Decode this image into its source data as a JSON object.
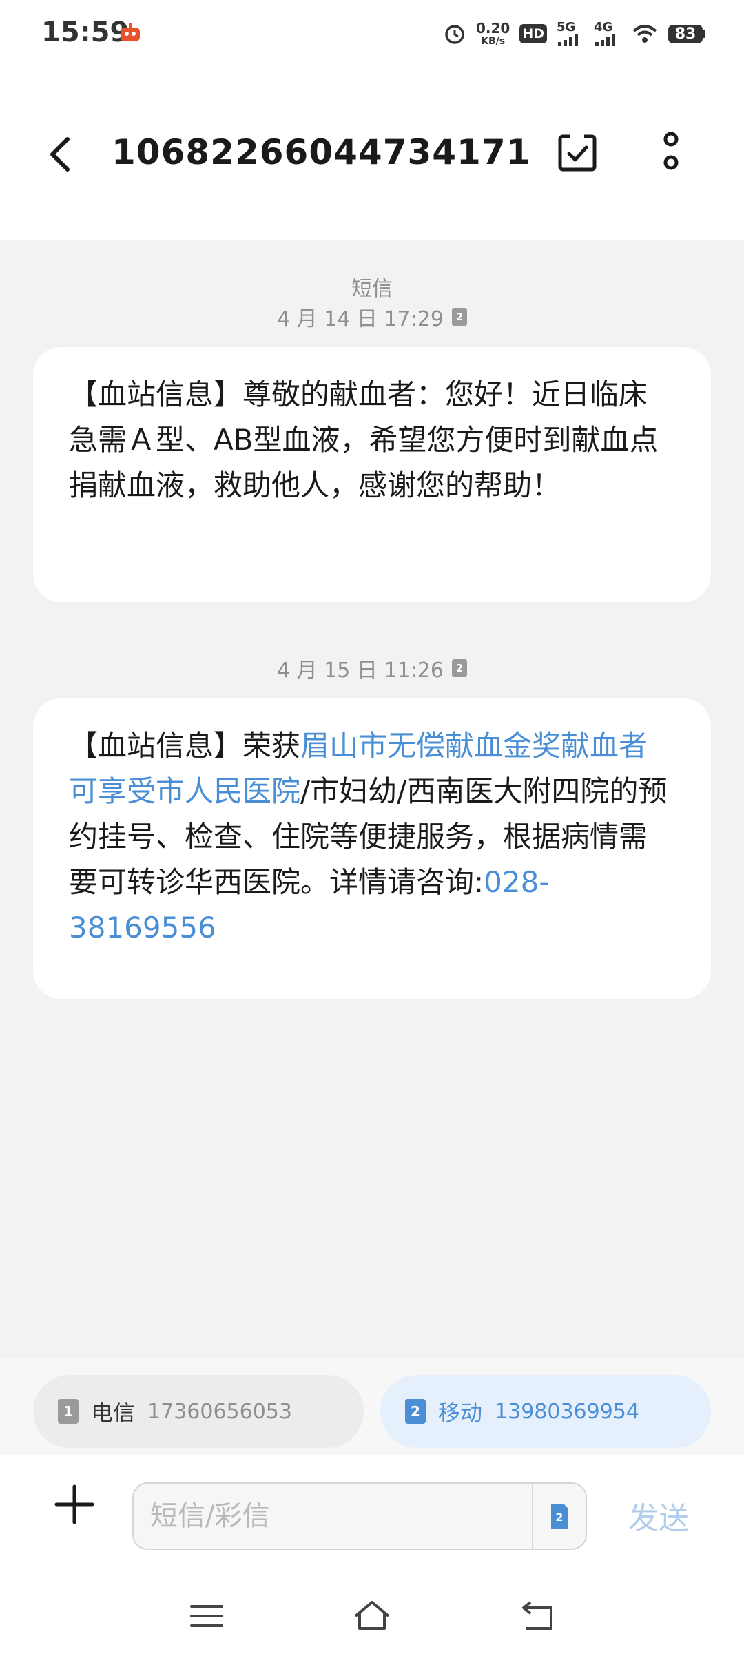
{
  "status_bar": {
    "time": "15:59",
    "net_speed_value": "0.20",
    "net_speed_unit": "KB/s",
    "hd_label": "HD",
    "network_1": "5G",
    "network_2": "4G",
    "battery": "83"
  },
  "header": {
    "title": "10682266044734171",
    "icons": [
      "back-arrow-icon",
      "select-check-icon",
      "more-vertical-icon"
    ]
  },
  "conversation": {
    "type_label": "短信",
    "messages": [
      {
        "timestamp": "4 月 14 日 17:29",
        "sim": "2",
        "text_parts": [
          "【血站信息】尊敬的献血者：您好！近日临床急需Ａ型、AB型血液，希望您方便时到献血点捐献血液，救助他人，感谢您的帮助！"
        ]
      },
      {
        "timestamp": "4 月 15 日 11:26",
        "sim": "2",
        "text_parts": [
          "【血站信息】荣获",
          "眉山市无偿献血金奖献血者可享受市人民医院",
          "/市妇幼/西南医大附四院的预约挂号、检查、住院等便捷服务，根据病情需要可转诊华西医院。详情请咨询:",
          "028-38169556"
        ]
      }
    ]
  },
  "sim_selector": {
    "sim1": {
      "index": "1",
      "carrier": "电信",
      "number": "17360656053"
    },
    "sim2": {
      "index": "2",
      "carrier": "移动",
      "number": "13980369954"
    }
  },
  "input_bar": {
    "placeholder": "短信/彩信",
    "sim_badge": "2",
    "send_label": "发送"
  },
  "colors": {
    "accent": "#4a8fd6",
    "background": "#f2f2f2",
    "bubble": "#ffffff",
    "send_disabled": "#b3cdea"
  },
  "nav_bar": {
    "icons": [
      "menu-icon",
      "home-icon",
      "back-icon"
    ]
  }
}
